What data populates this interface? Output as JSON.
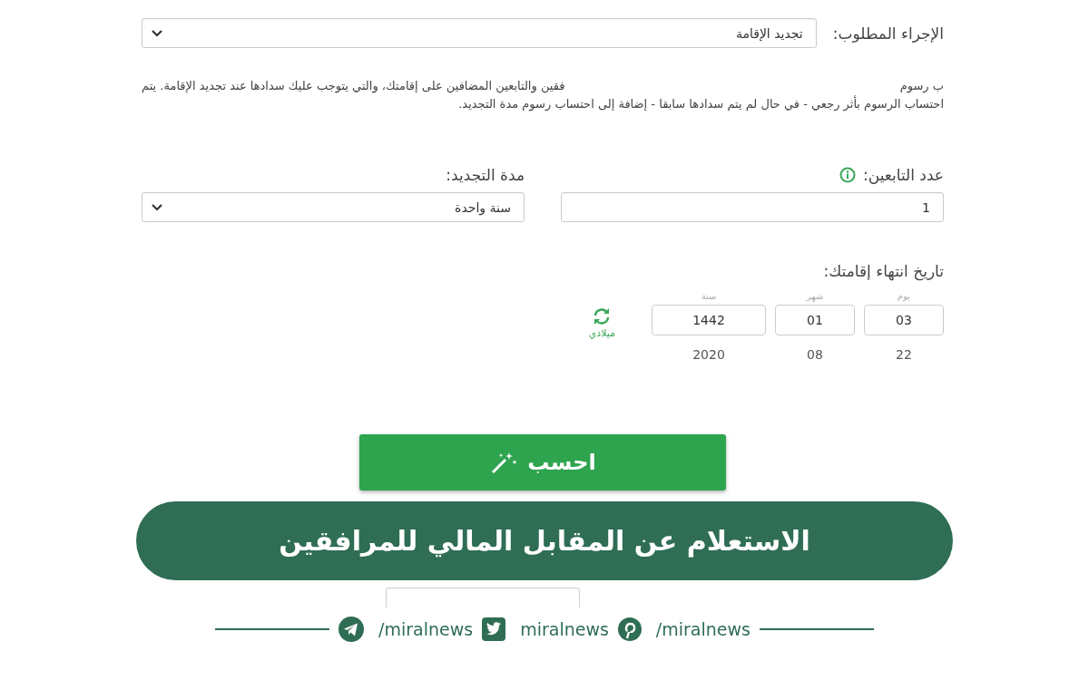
{
  "procedure": {
    "label": "الإجراء المطلوب:",
    "value": "تجديد الإقامة"
  },
  "note": {
    "fragment": "ب رسوم",
    "lines": [
      "فقين والتابعين المضافين على إقامتك، والتي يتوجب عليك سدادها عند تجديد الإقامة. يتم",
      "احتساب الرسوم بأثر رجعي - في حال لم يتم سدادها سابقا - إضافة إلى احتساب رسوم مدة التجديد."
    ]
  },
  "dependents": {
    "label": "عدد التابعين:",
    "value": "1"
  },
  "duration": {
    "label": "مدة التجديد:",
    "value": "سنة واحدة"
  },
  "expiry": {
    "label": "تاريخ انتهاء إقامتك:",
    "toggle": "ميلادي",
    "parts": [
      {
        "label": "يوم",
        "value": "03",
        "converted": "22"
      },
      {
        "label": "شهر",
        "value": "01",
        "converted": "08"
      },
      {
        "label": "سنة",
        "value": "1442",
        "converted": "2020"
      }
    ]
  },
  "calculate_button": "احسب",
  "banner": "الاستعلام عن المقابل المالي للمرافقين",
  "social": [
    {
      "kind": "pinterest",
      "handle": "/miralnews"
    },
    {
      "kind": "twitter",
      "handle": "miralnews"
    },
    {
      "kind": "telegram",
      "handle": "/miralnews"
    }
  ]
}
